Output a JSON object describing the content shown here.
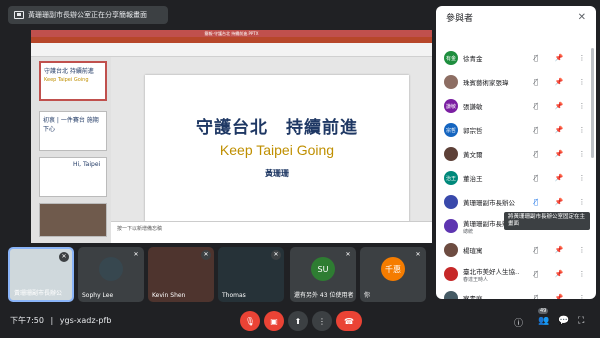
{
  "banner": {
    "text": "黃珊珊副市長辦公室正在分享簡報畫面"
  },
  "ppt": {
    "window_title": "簡報-守護台北 持續前進.PPTX",
    "thumb1": {
      "title": "守護台北 持續前進",
      "sub": "Keep Taipei Going"
    },
    "thumb2": {
      "title": "初衷 | 一件賽台 施期下心"
    },
    "thumb3": {
      "title": "Hi, Taipei"
    },
    "slide": {
      "title": "守護台北　持續前進",
      "subtitle": "Keep Taipei Going",
      "presenter": "黃珊珊"
    },
    "notes": "按一下以新增備忘稿"
  },
  "panel": {
    "title": "參與者",
    "participants": [
      {
        "name": "徐青金",
        "sub": "",
        "avatar_text": "有金",
        "avatar_color": "#1e8e3e"
      },
      {
        "name": "珠賓藝術家張瑋",
        "sub": "",
        "avatar_text": "",
        "avatar_color": "#8d6e63"
      },
      {
        "name": "張謙敏",
        "sub": "",
        "avatar_text": "謙敏",
        "avatar_color": "#7b1fa2"
      },
      {
        "name": "郭宗哲",
        "sub": "",
        "avatar_text": "宗哲",
        "avatar_color": "#1565c0"
      },
      {
        "name": "黃文爾",
        "sub": "",
        "avatar_text": "",
        "avatar_color": "#5d4037"
      },
      {
        "name": "董治王",
        "sub": "",
        "avatar_text": "治王",
        "avatar_color": "#00897b"
      },
      {
        "name": "黃珊珊副市長辦公",
        "sub": "",
        "avatar_text": "",
        "avatar_color": "#3949ab"
      },
      {
        "name": "黃珊珊副市長辦公",
        "sub": "總統",
        "avatar_text": "",
        "avatar_color": "#5e35b1"
      },
      {
        "name": "楊瑄寓",
        "sub": "",
        "avatar_text": "",
        "avatar_color": "#6d4c41"
      },
      {
        "name": "臺北市美好人生協…",
        "sub": "春達王時人",
        "avatar_text": "",
        "avatar_color": "#c62828"
      },
      {
        "name": "察素庭",
        "sub": "",
        "avatar_text": "",
        "avatar_color": "#455a64"
      }
    ],
    "tooltip": "將黃珊珊副市長辦公室固定在主畫面"
  },
  "tiles": [
    {
      "label": "黃珊珊副市長辦公",
      "avatar_text": "",
      "avatar_color": "#cfd8dc",
      "type": "video"
    },
    {
      "label": "Sophy Lee",
      "avatar_text": "",
      "avatar_color": "#37474f",
      "type": "avatar"
    },
    {
      "label": "Kevin Shen",
      "avatar_text": "",
      "avatar_color": "#4e342e",
      "type": "video"
    },
    {
      "label": "Thomas",
      "avatar_text": "",
      "avatar_color": "#263238",
      "type": "video"
    },
    {
      "label": "還有另外 43 位使用者",
      "avatar_text": "SU",
      "avatar_color": "#2e7d32",
      "type": "others"
    },
    {
      "label": "你",
      "avatar_text": "千惠",
      "avatar_color": "#f57c00",
      "type": "self"
    }
  ],
  "bottom": {
    "time": "下午7:50",
    "meeting_code": "ygs-xadz-pfb",
    "participant_badge": "49"
  },
  "icons": {
    "mic_off": "mic-off-icon",
    "cam_off": "camera-off-icon",
    "present": "present-icon",
    "more": "more-icon",
    "end_call": "end-call-icon",
    "info": "info-icon",
    "people": "people-icon",
    "chat": "chat-icon",
    "activities": "activities-icon"
  },
  "colors": {
    "end_call": "#ea4335",
    "accent": "#8ab4f8"
  }
}
